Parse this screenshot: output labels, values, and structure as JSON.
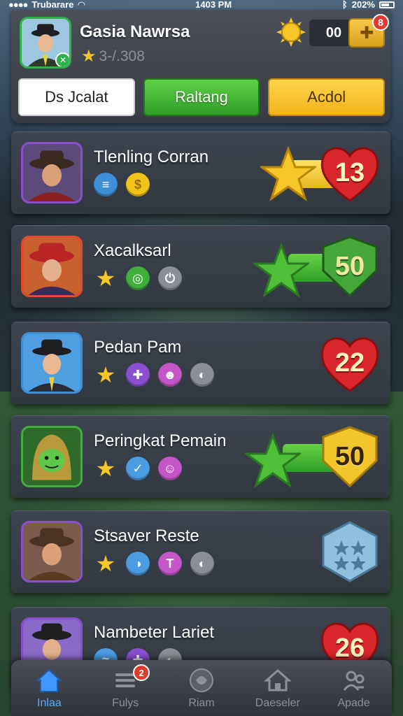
{
  "status_bar": {
    "carrier": "Trubarare",
    "time": "1403 PM",
    "battery": "202%"
  },
  "header": {
    "player_name": "Gasia Nawrsa",
    "player_rank": "3-/.308",
    "coins": "00",
    "gift_badge": "8",
    "tabs": [
      "Ds Jcalat",
      "Raltang",
      "Acdol"
    ]
  },
  "players": [
    {
      "name": "Tlenling Corran",
      "score": "13",
      "score_shape": "heart",
      "bar": "gold",
      "icons": [
        "blue",
        "gold"
      ],
      "frame": "#8a4fd1"
    },
    {
      "name": "Xacalksarl",
      "score": "50",
      "score_shape": "shield-green",
      "bar": "green",
      "icons": [
        "star",
        "green",
        "gray"
      ],
      "frame": "#e44a2a"
    },
    {
      "name": "Pedan Pam",
      "score": "22",
      "score_shape": "heart",
      "bar": "",
      "icons": [
        "star",
        "purple",
        "pink",
        "gray"
      ],
      "frame": "#3f8ed8"
    },
    {
      "name": "Peringkat Pemain",
      "score": "50",
      "score_shape": "shield-gold",
      "bar": "green",
      "icons": [
        "star",
        "lblue",
        "pink"
      ],
      "frame": "#3fae3a"
    },
    {
      "name": "Stsaver Reste",
      "score": "",
      "score_shape": "badge-stars",
      "bar": "",
      "icons": [
        "star",
        "lblue",
        "pink",
        "gray"
      ],
      "frame": "#8a4fd1"
    },
    {
      "name": "Nambeter Lariet",
      "score": "26",
      "score_shape": "heart",
      "bar": "",
      "icons": [
        "lblue",
        "purple",
        "gray"
      ],
      "frame": "#8a4fd1"
    }
  ],
  "bottom_nav": [
    {
      "label": "Inlaa",
      "icon": "home-icon",
      "active": true
    },
    {
      "label": "Fulys",
      "icon": "list-icon",
      "badge": "2"
    },
    {
      "label": "Riam",
      "icon": "ball-icon"
    },
    {
      "label": "Daeseler",
      "icon": "house-icon"
    },
    {
      "label": "Apade",
      "icon": "people-icon"
    }
  ],
  "colors": {
    "accent_green": "#3fae3a",
    "accent_gold": "#f2b21b",
    "heart_red": "#d9262a",
    "nav_active": "#58a9ff"
  }
}
